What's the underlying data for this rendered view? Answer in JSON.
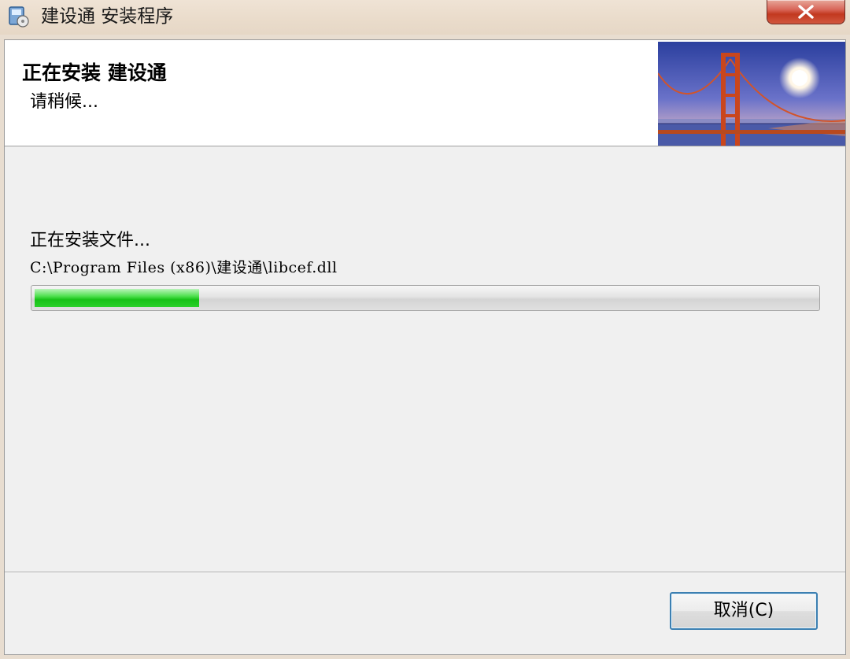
{
  "window": {
    "title": "建设通 安装程序",
    "close_glyph": "✕",
    "icons": [
      "installer-app-icon",
      "close-icon"
    ]
  },
  "header": {
    "title": "正在安装 建设通",
    "subtitle": "请稍候...",
    "banner": "golden-gate-bridge-image"
  },
  "main": {
    "status": "正在安装文件...",
    "file_path": "C:\\Program Files (x86)\\建设通\\libcef.dll",
    "progress_fraction": 0.21
  },
  "footer": {
    "cancel_label": "取消(C)"
  },
  "colors": {
    "progress": "#1ec81e",
    "close_button": "#c8432c",
    "focus_border": "#3c7fb1"
  }
}
